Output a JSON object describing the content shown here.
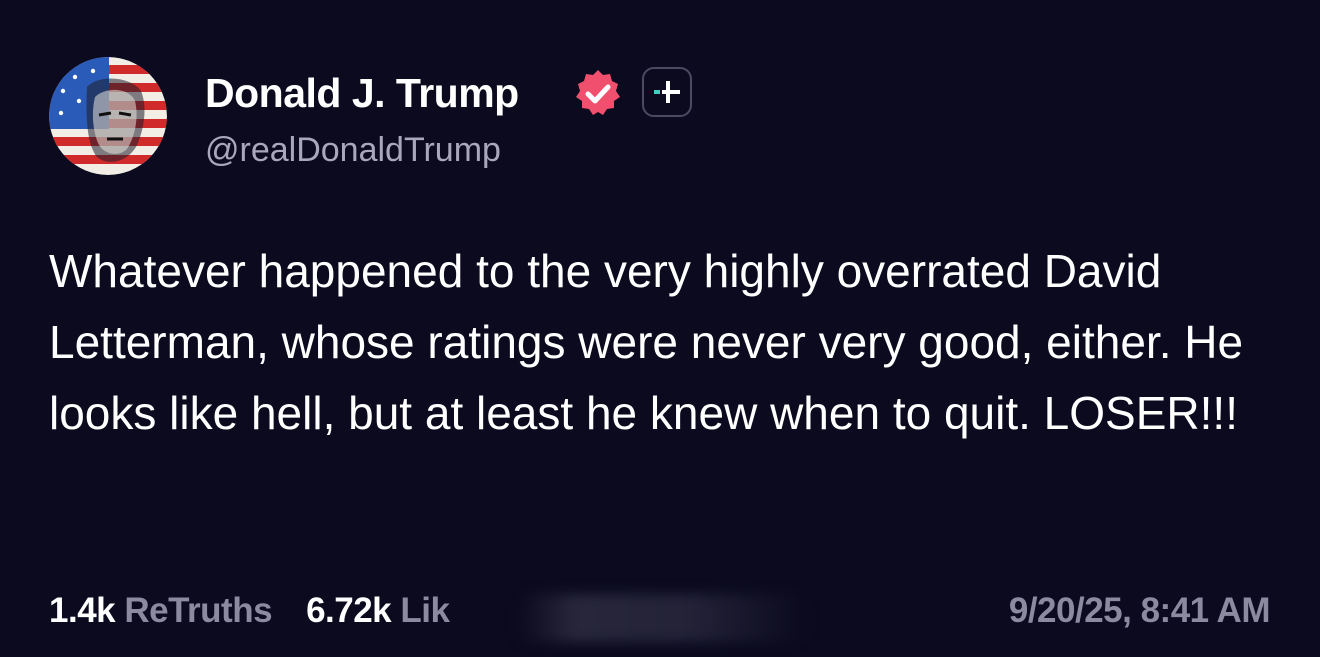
{
  "author": {
    "display_name": "Donald J. Trump",
    "handle": "@realDonaldTrump",
    "avatar_icon": "flag-portrait-avatar",
    "verified_icon": "verified-badge-icon",
    "follow_icon": "plus-icon"
  },
  "post": {
    "text": "Whatever happened to the very highly overrated David Letterman, whose ratings were never very good, either. He looks like hell, but at least he knew when to quit. LOSER!!!"
  },
  "stats": {
    "retruths_count": "1.4k",
    "retruths_label": "ReTruths",
    "likes_count": "6.72k",
    "likes_label": "Lik"
  },
  "timestamp": "9/20/25, 8:41 AM",
  "colors": {
    "background": "#0b0a1e",
    "verified": "#f0506e",
    "accent_teal": "#3fd0c0",
    "muted_text": "#8b8aa0"
  }
}
